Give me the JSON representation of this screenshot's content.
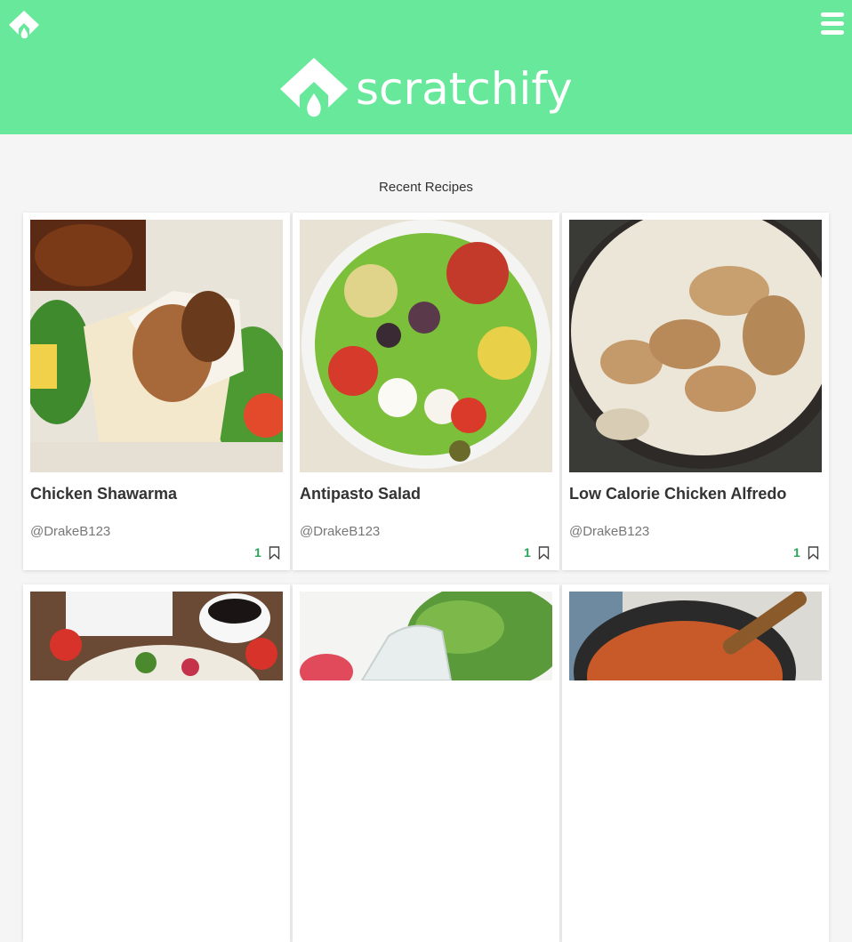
{
  "header": {
    "brand_name": "scratchify",
    "small_logo_icon": "scratchify-logo-icon",
    "menu_icon": "hamburger-menu-icon",
    "background_color": "#68e89a"
  },
  "section": {
    "title": "Recent Recipes"
  },
  "recipes": [
    {
      "title": "Chicken Shawarma",
      "author": "@DrakeB123",
      "likes": "1",
      "image": "chicken-shawarma-photo"
    },
    {
      "title": "Antipasto Salad",
      "author": "@DrakeB123",
      "likes": "1",
      "image": "antipasto-salad-photo"
    },
    {
      "title": "Low Calorie Chicken Alfredo",
      "author": "@DrakeB123",
      "likes": "1",
      "image": "chicken-alfredo-photo"
    },
    {
      "title": "",
      "author": "",
      "likes": "",
      "image": "strawberry-salad-photo"
    },
    {
      "title": "",
      "author": "",
      "likes": "",
      "image": "greens-and-dressing-photo"
    },
    {
      "title": "",
      "author": "",
      "likes": "",
      "image": "spanish-rice-pot-photo"
    }
  ],
  "colors": {
    "accent": "#68e89a",
    "like_count": "#27a35a"
  }
}
